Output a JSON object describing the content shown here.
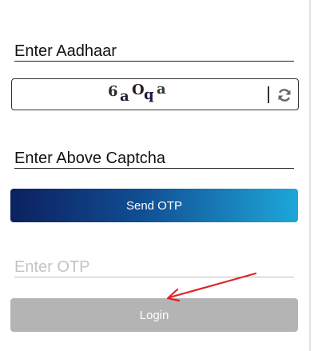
{
  "form": {
    "aadhaar_label": "Enter Aadhaar",
    "captcha": {
      "chars": [
        "6",
        "a",
        "O",
        "q",
        "a"
      ]
    },
    "captcha_label": "Enter Above Captcha",
    "send_otp_label": "Send OTP",
    "otp_placeholder": "Enter OTP",
    "login_label": "Login"
  },
  "icons": {
    "refresh": "refresh-icon",
    "annotation": "red-arrow-annotation"
  },
  "colors": {
    "send_gradient_start": "#0c2160",
    "send_gradient_end": "#1ea7d9",
    "login_disabled": "#b4b4b4",
    "annotation_red": "#e02424"
  }
}
